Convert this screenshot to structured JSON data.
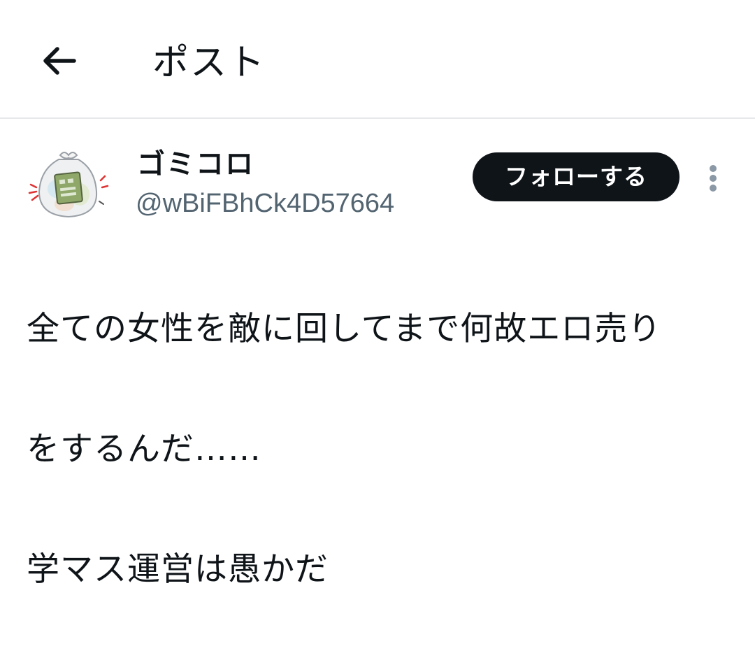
{
  "header": {
    "back_icon": "arrow-left-icon",
    "title": "ポスト"
  },
  "post": {
    "author": {
      "display_name": "ゴミコロ",
      "handle": "@wBiFBhCk4D57664",
      "avatar": "trash-bag-avatar"
    },
    "follow_label": "フォローする",
    "more_icon": "more-vertical-icon",
    "text_lines": [
      "全ての女性を敵に回してまで何故エロ売り",
      "をするんだ……",
      "学マス運営は愚かだ"
    ]
  },
  "colors": {
    "text": "#0f1419",
    "secondary": "#536471",
    "button_bg": "#0f1419",
    "button_text": "#ffffff",
    "divider": "#e6e8ea"
  }
}
